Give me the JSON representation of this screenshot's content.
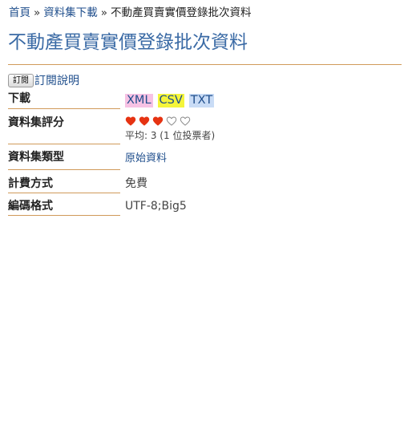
{
  "breadcrumb": {
    "home": "首頁",
    "separator": "»",
    "downloads": "資料集下載",
    "current": "不動產買賣實價登錄批次資料"
  },
  "page": {
    "title": "不動產買賣實價登錄批次資料"
  },
  "subscribe": {
    "button_label": "訂閱",
    "help_link": "訂閱說明"
  },
  "fields": {
    "download": {
      "label": "下載",
      "links": [
        {
          "text": "XML",
          "color": "#f7c2e4"
        },
        {
          "text": "CSV",
          "color": "#f5f53a"
        },
        {
          "text": "TXT",
          "color": "#c9dcf6"
        }
      ]
    },
    "rating": {
      "label": "資料集評分",
      "value": 3,
      "max": 5,
      "average_text": "平均: 3 (1 位投票者)",
      "filled_color": "#e63312",
      "empty_color": "#888888"
    },
    "type": {
      "label": "資料集類型",
      "value": "原始資料"
    },
    "fee": {
      "label": "計費方式",
      "value": "免費"
    },
    "encoding": {
      "label": "編碼格式",
      "value": "UTF-8;Big5"
    }
  },
  "colors": {
    "link": "#1f4e8c",
    "title": "#3a6aa5",
    "rule": "#d09a5a"
  }
}
